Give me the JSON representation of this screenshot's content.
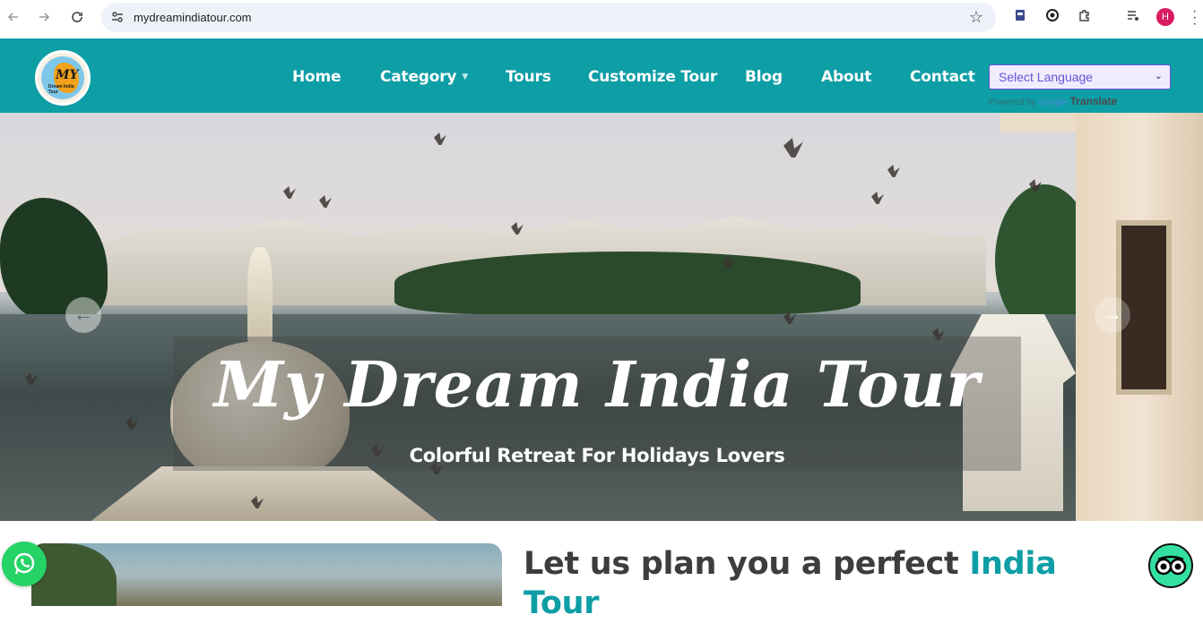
{
  "browser": {
    "url": "mydreamindiatour.com",
    "profile_initial": "H",
    "icons": [
      "back-arrow-icon",
      "forward-arrow-icon",
      "reload-icon",
      "site-info-icon",
      "bookmark-star-icon",
      "extension-icon",
      "puzzle-icon",
      "media-icon",
      "kebab-menu-icon"
    ]
  },
  "header": {
    "logo_text": "MY",
    "logo_subtext": "Dream India Tour",
    "nav": [
      {
        "label": "Home"
      },
      {
        "label": "Category",
        "has_dropdown": true
      },
      {
        "label": "Tours"
      },
      {
        "label": "Customize Tour"
      },
      {
        "label": "Blog"
      },
      {
        "label": "About"
      },
      {
        "label": "Contact"
      }
    ],
    "language_select": {
      "selected": "Select Language",
      "powered_by": "Powered by",
      "google": "Google",
      "translate": "Translate"
    },
    "colors": {
      "header_bg": "#0e9ea5",
      "accent": "#0e9ea5"
    }
  },
  "hero": {
    "title": "My Dream India Tour",
    "subtitle": "Colorful Retreat For Holidays Lovers",
    "prev_arrow": "←",
    "next_arrow": "→"
  },
  "intro": {
    "title_plain": "Let us plan you a perfect ",
    "title_accent": "India Tour"
  },
  "floating": {
    "whatsapp": "whatsapp-icon",
    "tripadvisor": "tripadvisor-icon"
  }
}
